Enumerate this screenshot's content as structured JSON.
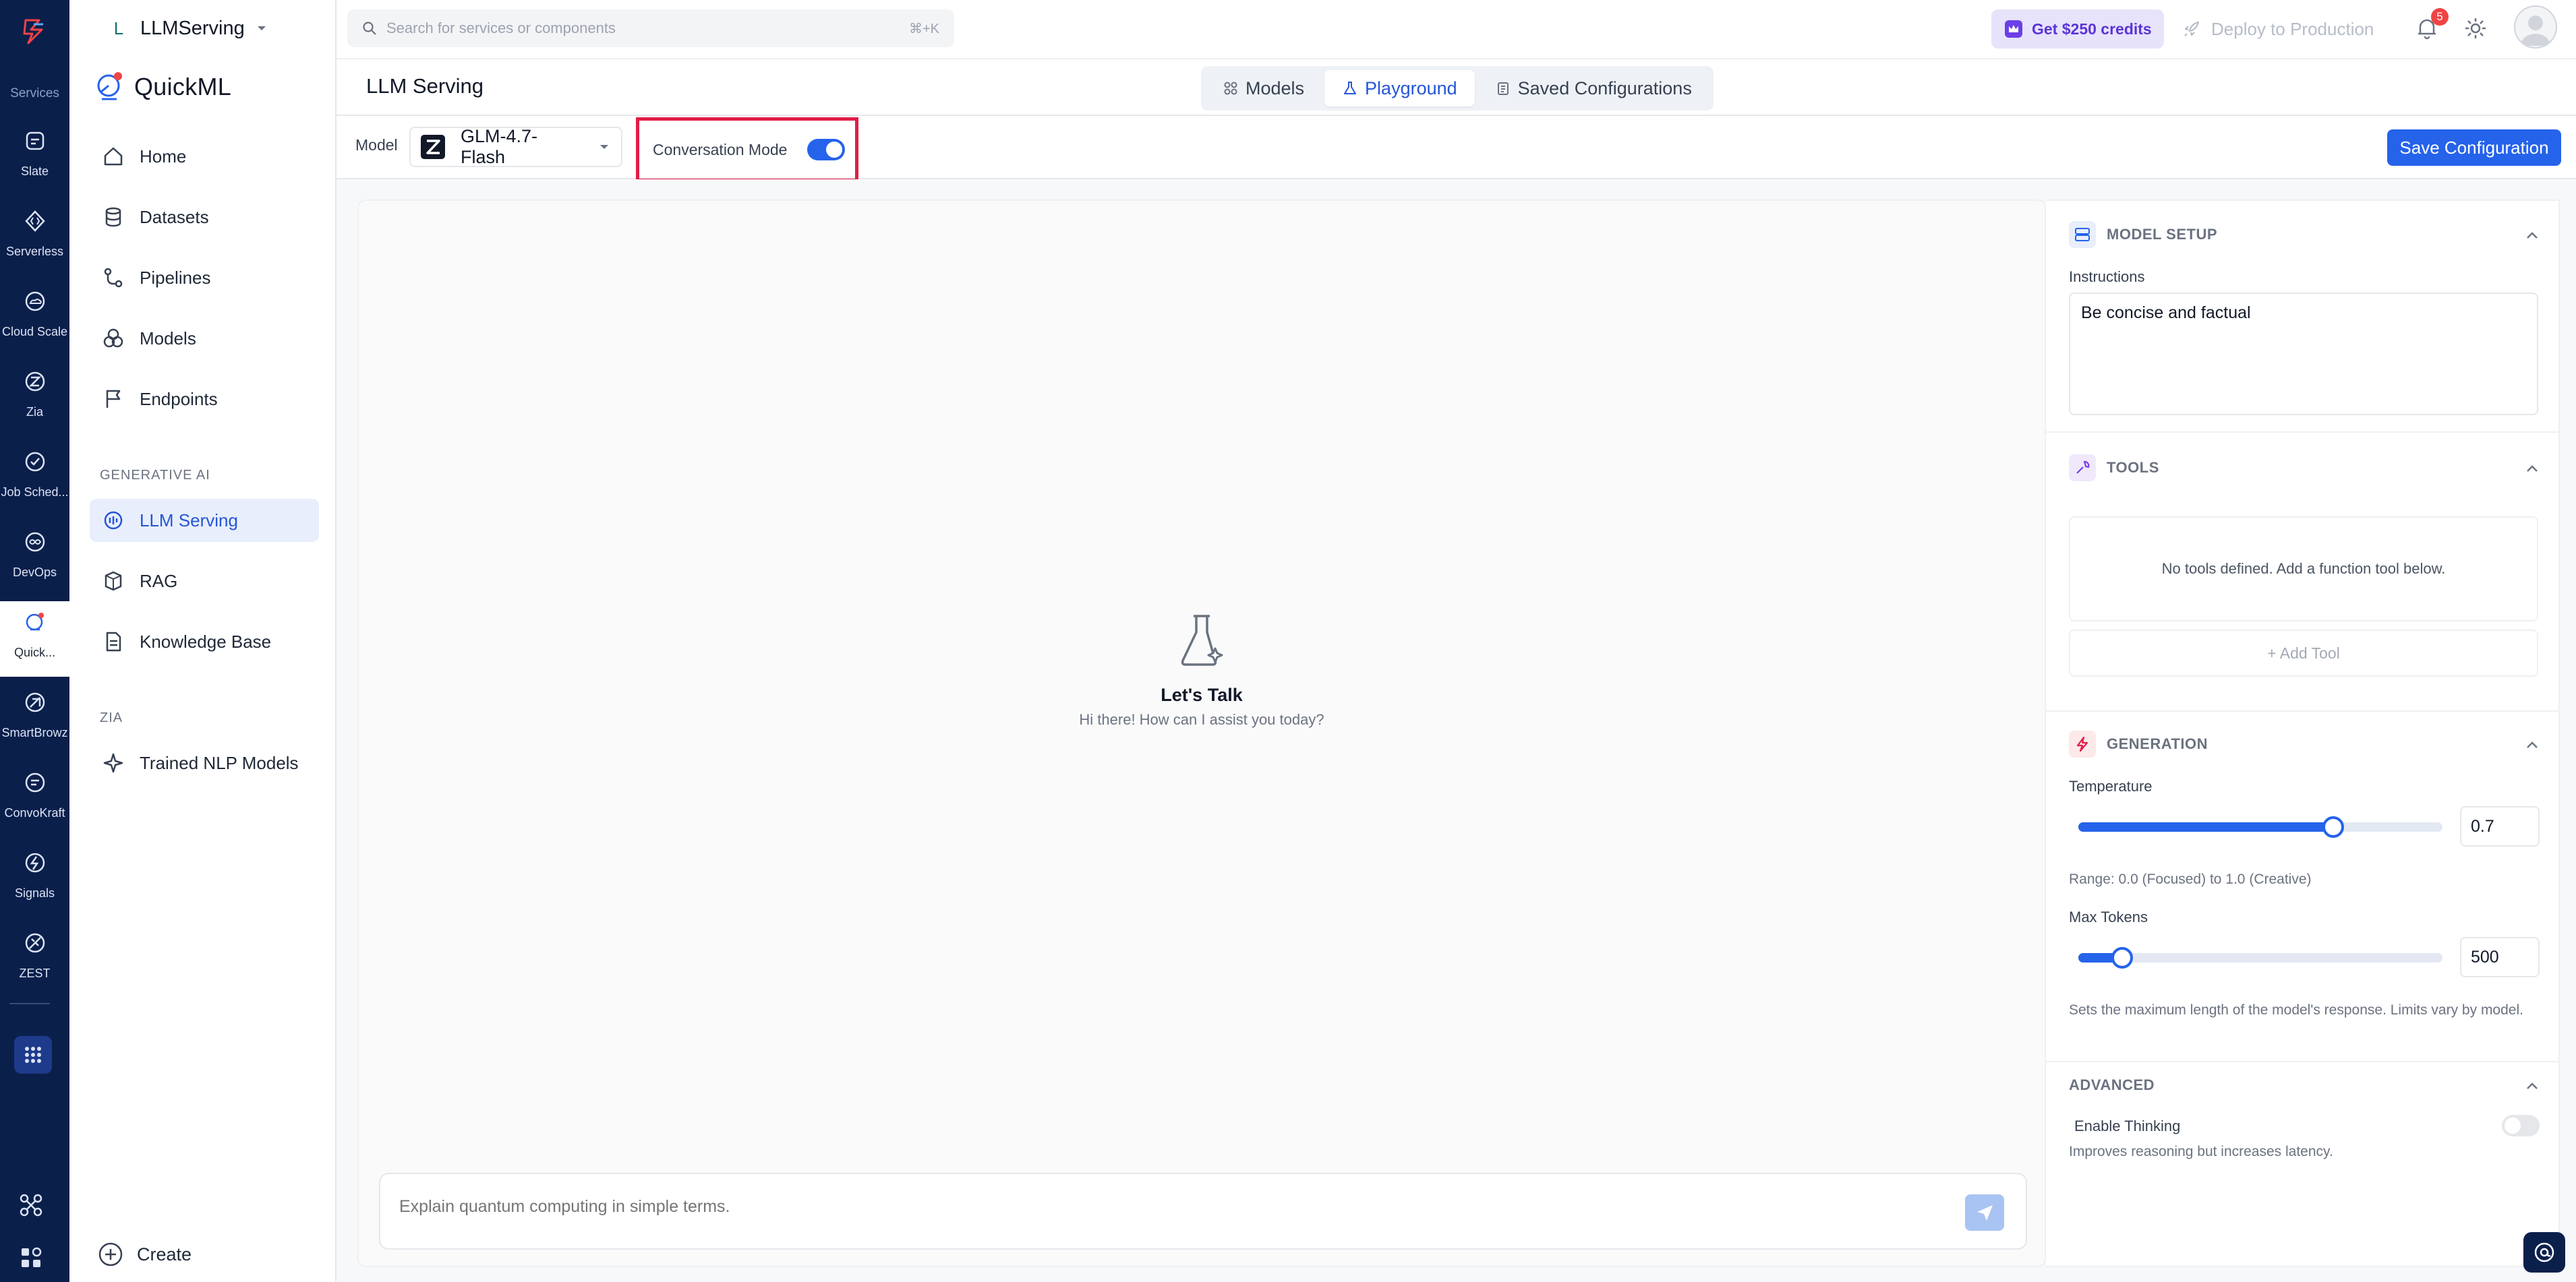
{
  "rail": {
    "services_label": "Services",
    "items": [
      {
        "label": "Slate",
        "icon": "slate-icon"
      },
      {
        "label": "Serverless",
        "icon": "serverless-icon"
      },
      {
        "label": "Cloud Scale",
        "icon": "cloud-scale-icon"
      },
      {
        "label": "Zia",
        "icon": "zia-icon"
      },
      {
        "label": "Job Sched...",
        "icon": "job-scheduler-icon"
      },
      {
        "label": "DevOps",
        "icon": "devops-icon"
      },
      {
        "label": "Quick...",
        "icon": "quickml-icon"
      },
      {
        "label": "SmartBrowz",
        "icon": "smartbrowz-icon"
      },
      {
        "label": "ConvoKraft",
        "icon": "convokraft-icon"
      },
      {
        "label": "Signals",
        "icon": "signals-icon"
      },
      {
        "label": "ZEST",
        "icon": "zest-icon"
      }
    ]
  },
  "topbar": {
    "project_initial": "L",
    "project_name": "LLMServing",
    "search_placeholder": "Search for services or components",
    "search_shortcut": "⌘+K",
    "credits_label": "Get $250 credits",
    "deploy_label": "Deploy to Production",
    "notification_count": "5"
  },
  "sidebar": {
    "brand": "QuickML",
    "nav": [
      {
        "label": "Home",
        "icon": "home-icon"
      },
      {
        "label": "Datasets",
        "icon": "database-icon"
      },
      {
        "label": "Pipelines",
        "icon": "pipeline-icon"
      },
      {
        "label": "Models",
        "icon": "models-icon"
      },
      {
        "label": "Endpoints",
        "icon": "flag-icon"
      }
    ],
    "section_genai": "GENERATIVE AI",
    "genai_items": [
      {
        "label": "LLM Serving",
        "icon": "llm-serving-icon",
        "active": true
      },
      {
        "label": "RAG",
        "icon": "rag-icon"
      },
      {
        "label": "Knowledge Base",
        "icon": "document-icon"
      }
    ],
    "section_zia": "ZIA",
    "zia_items": [
      {
        "label": "Trained NLP Models",
        "icon": "sparkle-icon"
      }
    ],
    "create_label": "Create"
  },
  "header": {
    "title": "LLM Serving",
    "tabs": [
      {
        "label": "Models",
        "icon": "grid-icon"
      },
      {
        "label": "Playground",
        "icon": "flask-icon",
        "active": true
      },
      {
        "label": "Saved Configurations",
        "icon": "clipboard-icon"
      }
    ]
  },
  "toolbar": {
    "model_label": "Model",
    "model_value": "GLM-4.7-Flash",
    "conversation_mode_label": "Conversation Mode",
    "conversation_mode_on": true,
    "save_label": "Save Configuration"
  },
  "chat": {
    "empty_title": "Let's Talk",
    "empty_subtitle": "Hi there! How can I assist you today?",
    "composer_placeholder": "Explain quantum computing in simple terms."
  },
  "panel": {
    "model_setup": {
      "title": "MODEL SETUP",
      "instructions_label": "Instructions",
      "instructions_value": "Be concise and factual"
    },
    "tools": {
      "title": "TOOLS",
      "empty_text": "No tools defined. Add a function tool below.",
      "add_label": "+ Add Tool"
    },
    "generation": {
      "title": "GENERATION",
      "temperature_label": "Temperature",
      "temperature_value": "0.7",
      "temperature_fraction": 0.7,
      "temperature_help": "Range: 0.0 (Focused) to 1.0 (Creative)",
      "max_tokens_label": "Max Tokens",
      "max_tokens_value": "500",
      "max_tokens_fraction": 0.12,
      "max_tokens_help": "Sets the maximum length of the model's response. Limits vary by model."
    },
    "advanced": {
      "title": "ADVANCED",
      "thinking_label": "Enable Thinking",
      "thinking_on": false,
      "thinking_help": "Improves reasoning but increases latency."
    }
  },
  "colors": {
    "accent": "#2563eb",
    "rail_bg": "#0b1f4b",
    "highlight_box": "#e11d48",
    "credits_bg": "#e7e3fb"
  }
}
